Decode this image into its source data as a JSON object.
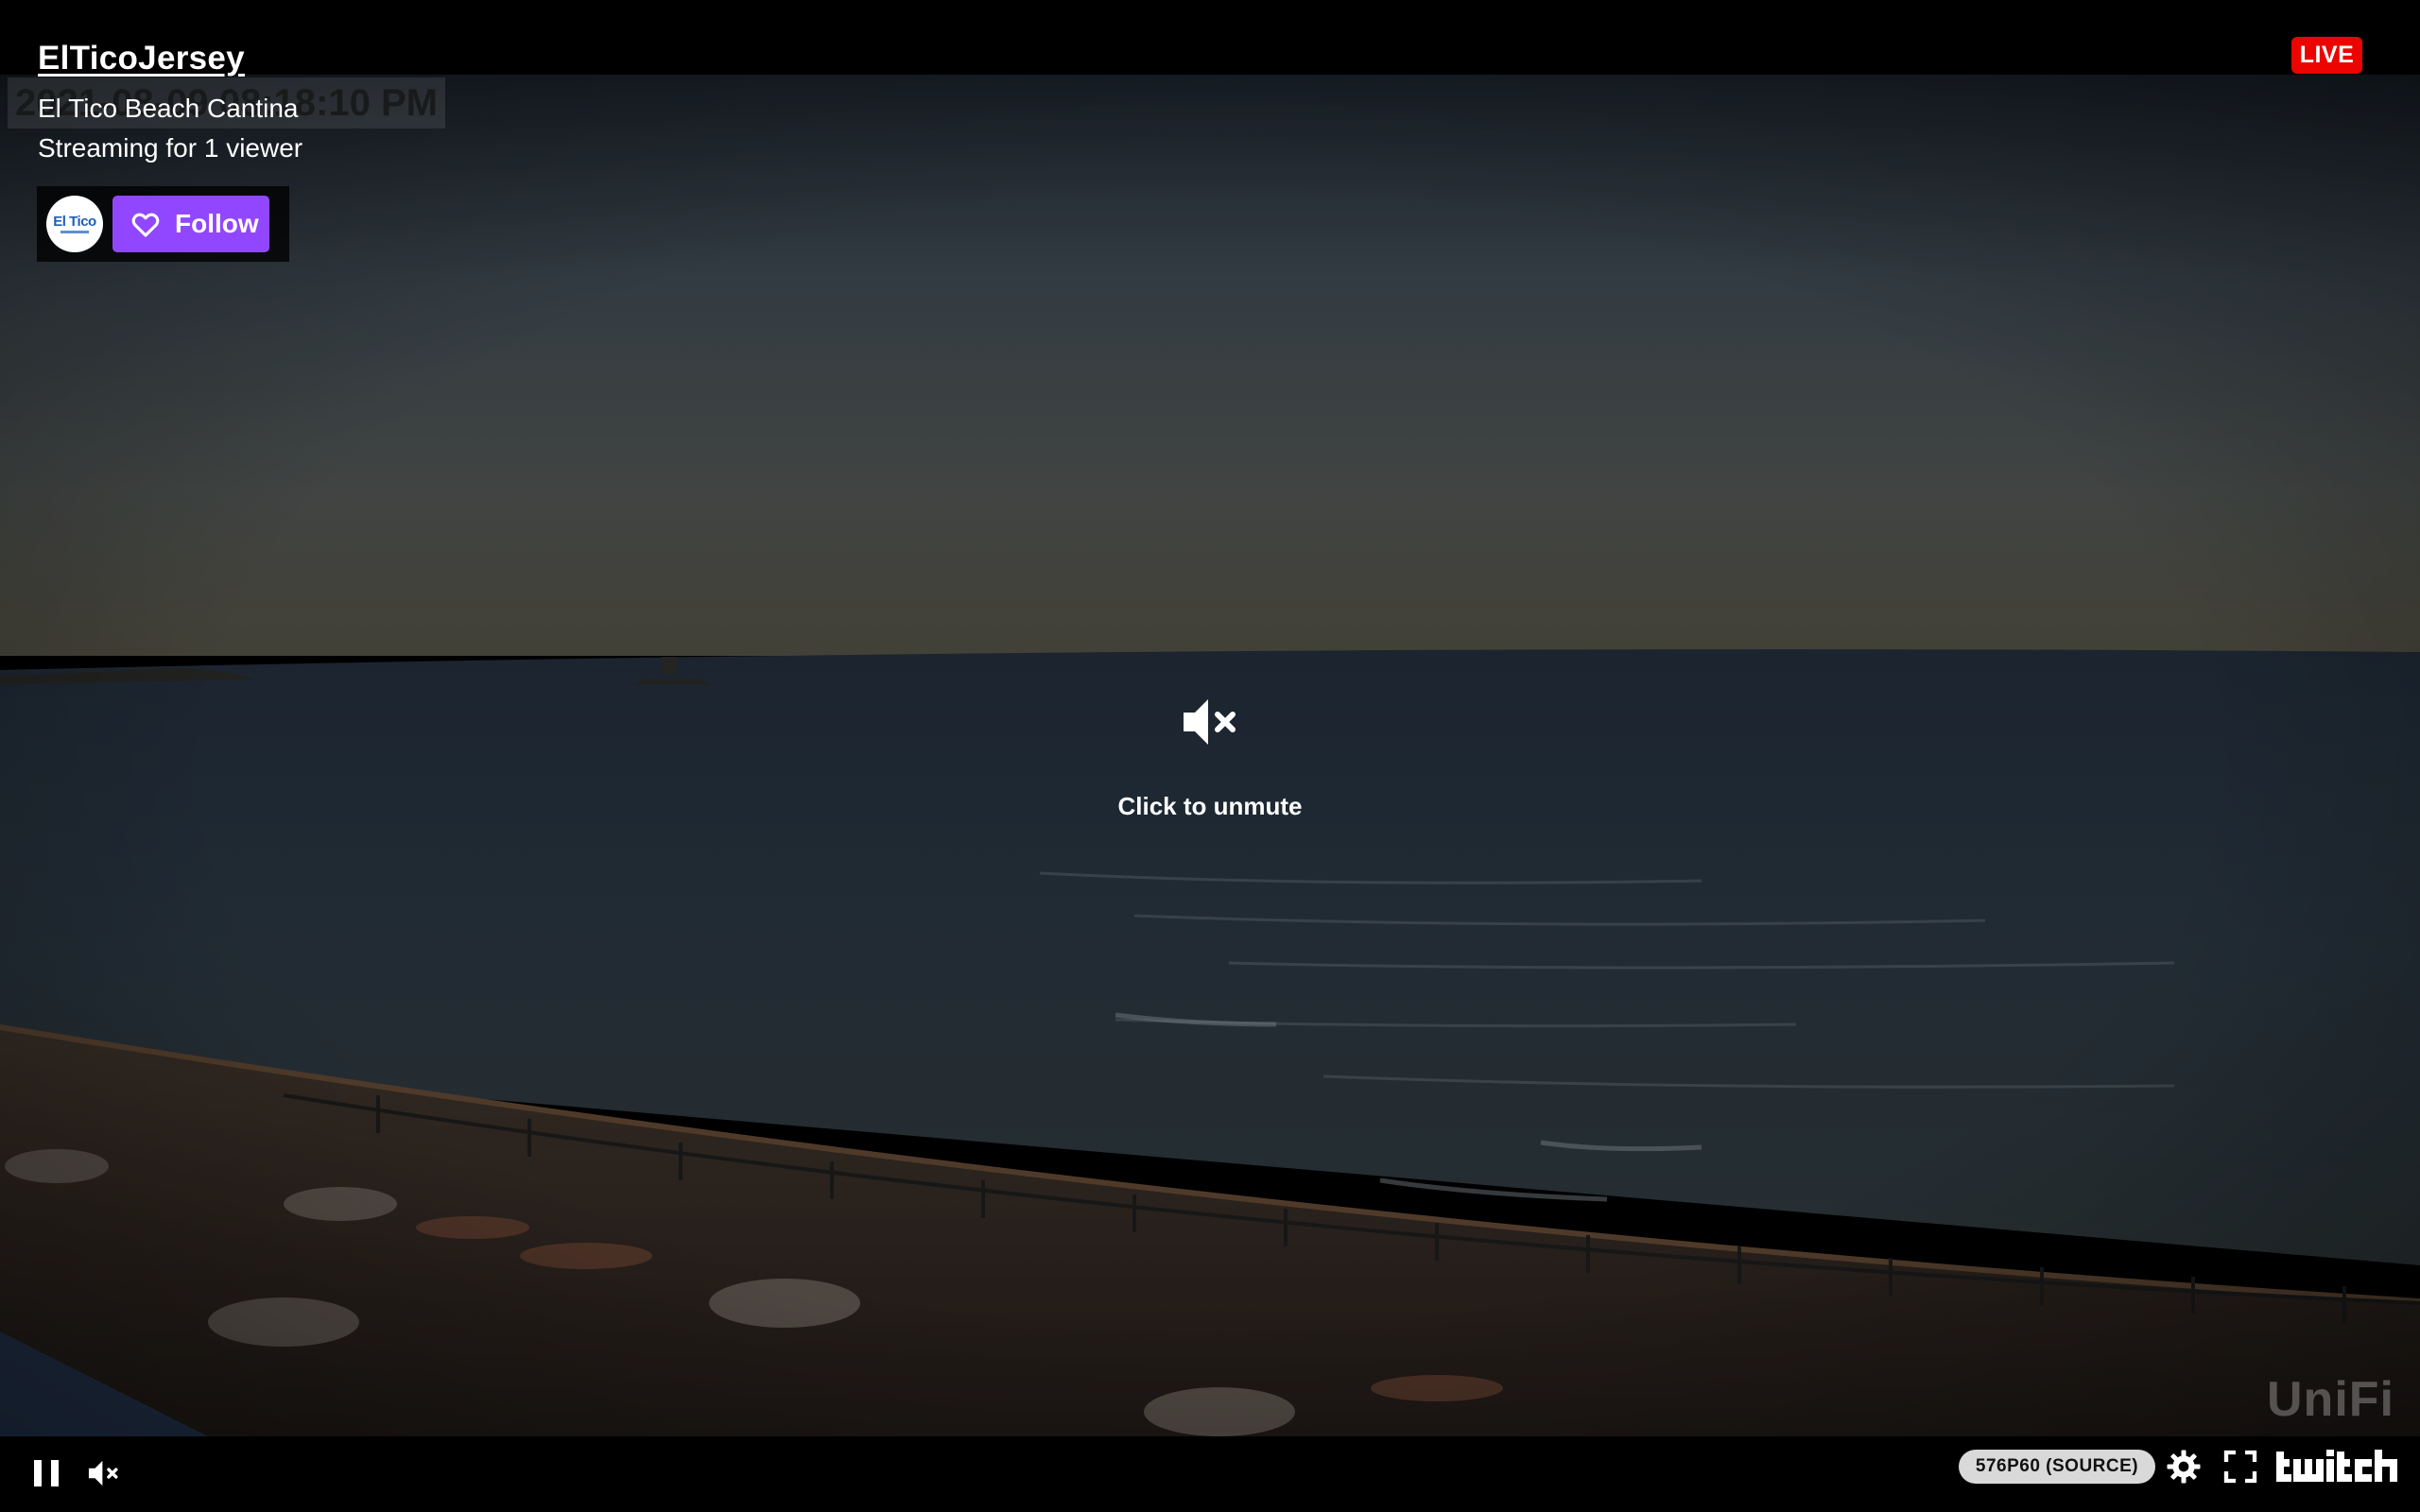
{
  "player": {
    "channel_name": "ElTicoJersey",
    "stream_title": "El Tico Beach Cantina",
    "viewer_line": "Streaming for 1 viewer",
    "live_label": "LIVE",
    "avatar_text": "El Tico",
    "follow_label": "Follow",
    "unmute_text": "Click to unmute",
    "accent_color": "#9147ff",
    "live_color": "#eb0400"
  },
  "video_overlay": {
    "timestamp": "2021-08-09 08:18:10 PM",
    "watermark": "UniFi"
  },
  "controls": {
    "quality_label": "576P60 (SOURCE)",
    "icons": [
      "pause-icon",
      "volume-muted-icon",
      "settings-icon",
      "fullscreen-icon",
      "twitch-logo"
    ]
  }
}
